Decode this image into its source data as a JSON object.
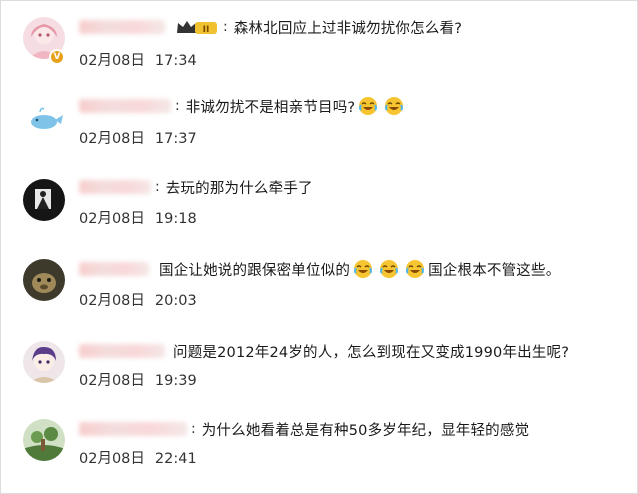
{
  "comments": [
    {
      "text": "森林北回应上过非诚勿扰你怎么看?",
      "date": "02月08日",
      "time": "17:34",
      "colon": ":",
      "badge_label": "II",
      "avatar_icon": "anime-girl-avatar-icon"
    },
    {
      "text": "非诚勿扰不是相亲节目吗?",
      "date": "02月08日",
      "time": "17:37",
      "colon": ":",
      "avatar_icon": "whale-avatar-icon"
    },
    {
      "text": "去玩的那为什么牵手了",
      "date": "02月08日",
      "time": "19:18",
      "colon": ":",
      "avatar_icon": "dark-photo-avatar-icon"
    },
    {
      "text_part1": "国企让她说的跟保密单位似的",
      "text_part2": "国企根本不管这些。",
      "date": "02月08日",
      "time": "20:03",
      "avatar_icon": "animal-avatar-icon"
    },
    {
      "text": "问题是2012年24岁的人，怎么到现在又变成1990年出生呢?",
      "date": "02月08日",
      "time": "19:39",
      "avatar_icon": "anime-boy-avatar-icon"
    },
    {
      "text": "为什么她看着总是有种50多岁年纪，显年轻的感觉",
      "date": "02月08日",
      "time": "22:41",
      "colon": ":",
      "avatar_icon": "plant-avatar-icon"
    }
  ],
  "colors": {
    "name_blur": "#f5d0d0",
    "badge_gold": "#e8a11a",
    "emoji_yellow": "#f7c531"
  }
}
